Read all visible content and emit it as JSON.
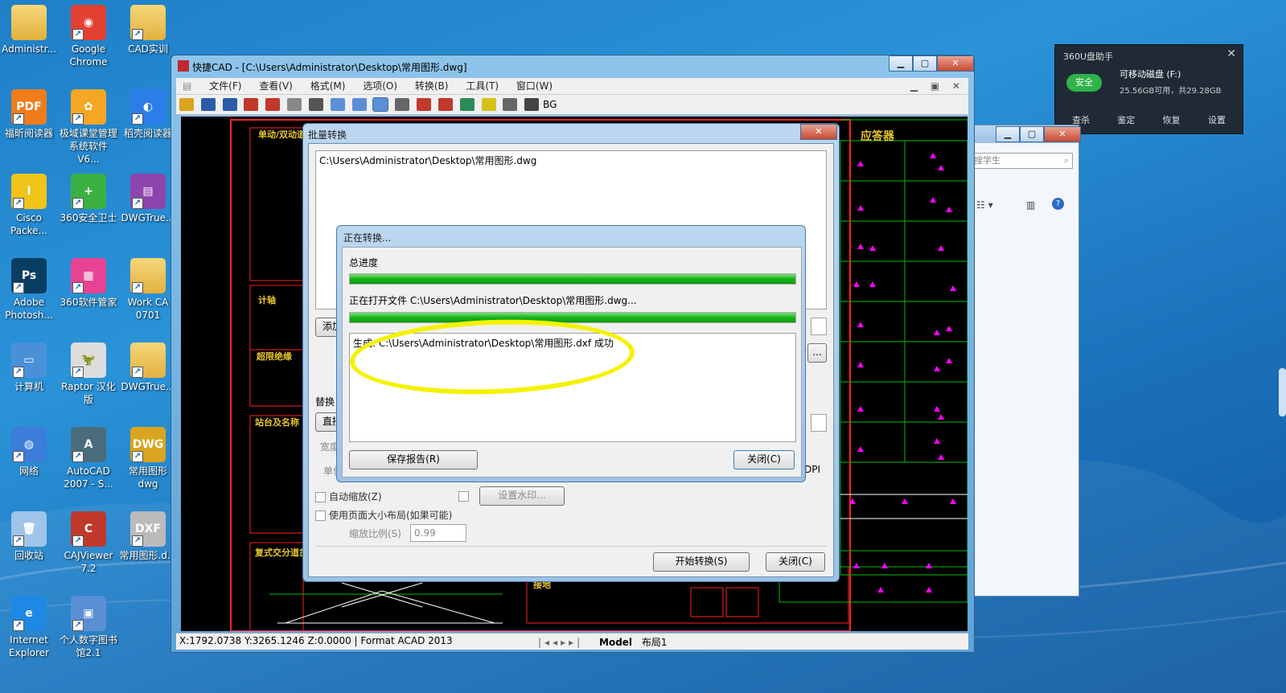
{
  "desktop": {
    "icons": [
      {
        "label": "Administr...",
        "icon": "user-folder-icon",
        "color": "#e9c15a",
        "glyph": ""
      },
      {
        "label": "Google\nChrome",
        "icon": "chrome-icon",
        "color": "#e34133",
        "glyph": "◉"
      },
      {
        "label": "CAD实训",
        "icon": "folder-icon",
        "color": "#e9c15a",
        "glyph": ""
      },
      {
        "label": "福昕阅读器",
        "icon": "foxit-icon",
        "color": "#f07c1b",
        "glyph": "PDF"
      },
      {
        "label": "极域课堂管理\n系统软件V6...",
        "icon": "classroom-icon",
        "color": "#f5a623",
        "glyph": "✿"
      },
      {
        "label": "稻壳阅读器",
        "icon": "docer-icon",
        "color": "#2b7de9",
        "glyph": "◐"
      },
      {
        "label": "Cisco\nPacke...",
        "icon": "cisco-icon",
        "color": "#f0c419",
        "glyph": "I"
      },
      {
        "label": "360安全卫士",
        "icon": "360-safe-icon",
        "color": "#3cb043",
        "glyph": "+"
      },
      {
        "label": "DWGTrue...",
        "icon": "winrar-icon",
        "color": "#8e44ad",
        "glyph": "▤"
      },
      {
        "label": "Adobe\nPhotosh...",
        "icon": "photoshop-icon",
        "color": "#0a3d62",
        "glyph": "Ps"
      },
      {
        "label": "360软件管家",
        "icon": "360-manager-icon",
        "color": "#e84393",
        "glyph": "▦"
      },
      {
        "label": "Work CA\n0701",
        "icon": "folder-icon",
        "color": "#e9c15a",
        "glyph": ""
      },
      {
        "label": "计算机",
        "icon": "computer-icon",
        "color": "#4a90d9",
        "glyph": "▭"
      },
      {
        "label": "Raptor 汉化\n版",
        "icon": "raptor-icon",
        "color": "#dddddd",
        "glyph": "🦖"
      },
      {
        "label": "DWGTrue...",
        "icon": "folder-icon",
        "color": "#e9c15a",
        "glyph": ""
      },
      {
        "label": "网络",
        "icon": "network-icon",
        "color": "#3b7dd8",
        "glyph": "◍"
      },
      {
        "label": "AutoCAD\n2007 - S...",
        "icon": "autocad-icon",
        "color": "#4a6d7c",
        "glyph": "A"
      },
      {
        "label": "常用图形\ndwg",
        "icon": "dwg-file-icon",
        "color": "#d9a520",
        "glyph": "DWG"
      },
      {
        "label": "回收站",
        "icon": "recycle-bin-icon",
        "color": "#9ec4e8",
        "glyph": "🗑"
      },
      {
        "label": "CAJViewer\n7.2",
        "icon": "cajviewer-icon",
        "color": "#c0392b",
        "glyph": "C"
      },
      {
        "label": "常用图形.d...",
        "icon": "dxf-file-icon",
        "color": "#bbbbbb",
        "glyph": "DXF"
      },
      {
        "label": "Internet\nExplorer",
        "icon": "ie-icon",
        "color": "#1e88e5",
        "glyph": "e"
      },
      {
        "label": "个人数字图书\n馆2.1",
        "icon": "library-icon",
        "color": "#5a8fd6",
        "glyph": "▣"
      }
    ]
  },
  "cad_window": {
    "title": "快捷CAD - [C:\\Users\\Administrator\\Desktop\\常用图形.dwg]",
    "menu": [
      "文件(F)",
      "查看(V)",
      "格式(M)",
      "选项(O)",
      "转换(B)",
      "工具(T)",
      "窗口(W)"
    ],
    "toolbar_bg_label": "BG",
    "status_coords": "X:1792.0738 Y:3265.1246 Z:0.0000 | Format ACAD 2013",
    "tabs": [
      "Model",
      "布局1"
    ],
    "drawing_labels": {
      "left": [
        "单动/双动道",
        "计轴",
        "超限绝缘",
        "站台及名称",
        "复式交分道岔"
      ],
      "right_title": "应答器",
      "bottom": "接地"
    }
  },
  "batch_dialog": {
    "title": "批量转换",
    "file_item": "C:\\Users\\Administrator\\Desktop\\常用图形.dwg",
    "add_button": "添加",
    "replace_label": "替换",
    "direct_label": "直接",
    "width_label": "宽度",
    "unit_label": "单位",
    "dpi_label": "DPI",
    "browse_button": "...",
    "auto_zoom": "自动缩放(Z)",
    "watermark_button": "设置水印...",
    "use_page_size": "使用页面大小布局(如果可能)",
    "scale_label": "缩放比例(S)",
    "scale_value": "0.99",
    "start_button": "开始转换(S)",
    "close_button": "关闭(C)"
  },
  "progress_dialog": {
    "title": "正在转换...",
    "total_label": "总进度",
    "total_progress": 100,
    "opening_label": "正在打开文件 C:\\Users\\Administrator\\Desktop\\常用图形.dwg...",
    "file_progress": 100,
    "log": "生成: C:\\Users\\Administrator\\Desktop\\常用图形.dxf 成功",
    "save_report_button": "保存报告(R)",
    "close_button": "关闭(C)"
  },
  "u_disk_assistant": {
    "title": "360U盘助手",
    "status_badge": "安全",
    "device": "可移动磁盘 (F:)",
    "space": "25.56GB可用，共29.28GB",
    "actions": [
      "查杀",
      "鉴定",
      "恢复",
      "设置"
    ]
  },
  "explorer_window": {
    "search_placeholder": "搜学生"
  },
  "colors": {
    "cad_red": "#ff2020",
    "cad_green": "#00c000",
    "cad_magenta": "#ff00ff",
    "highlight": "#f4f200",
    "progress_green": "#17b317"
  }
}
